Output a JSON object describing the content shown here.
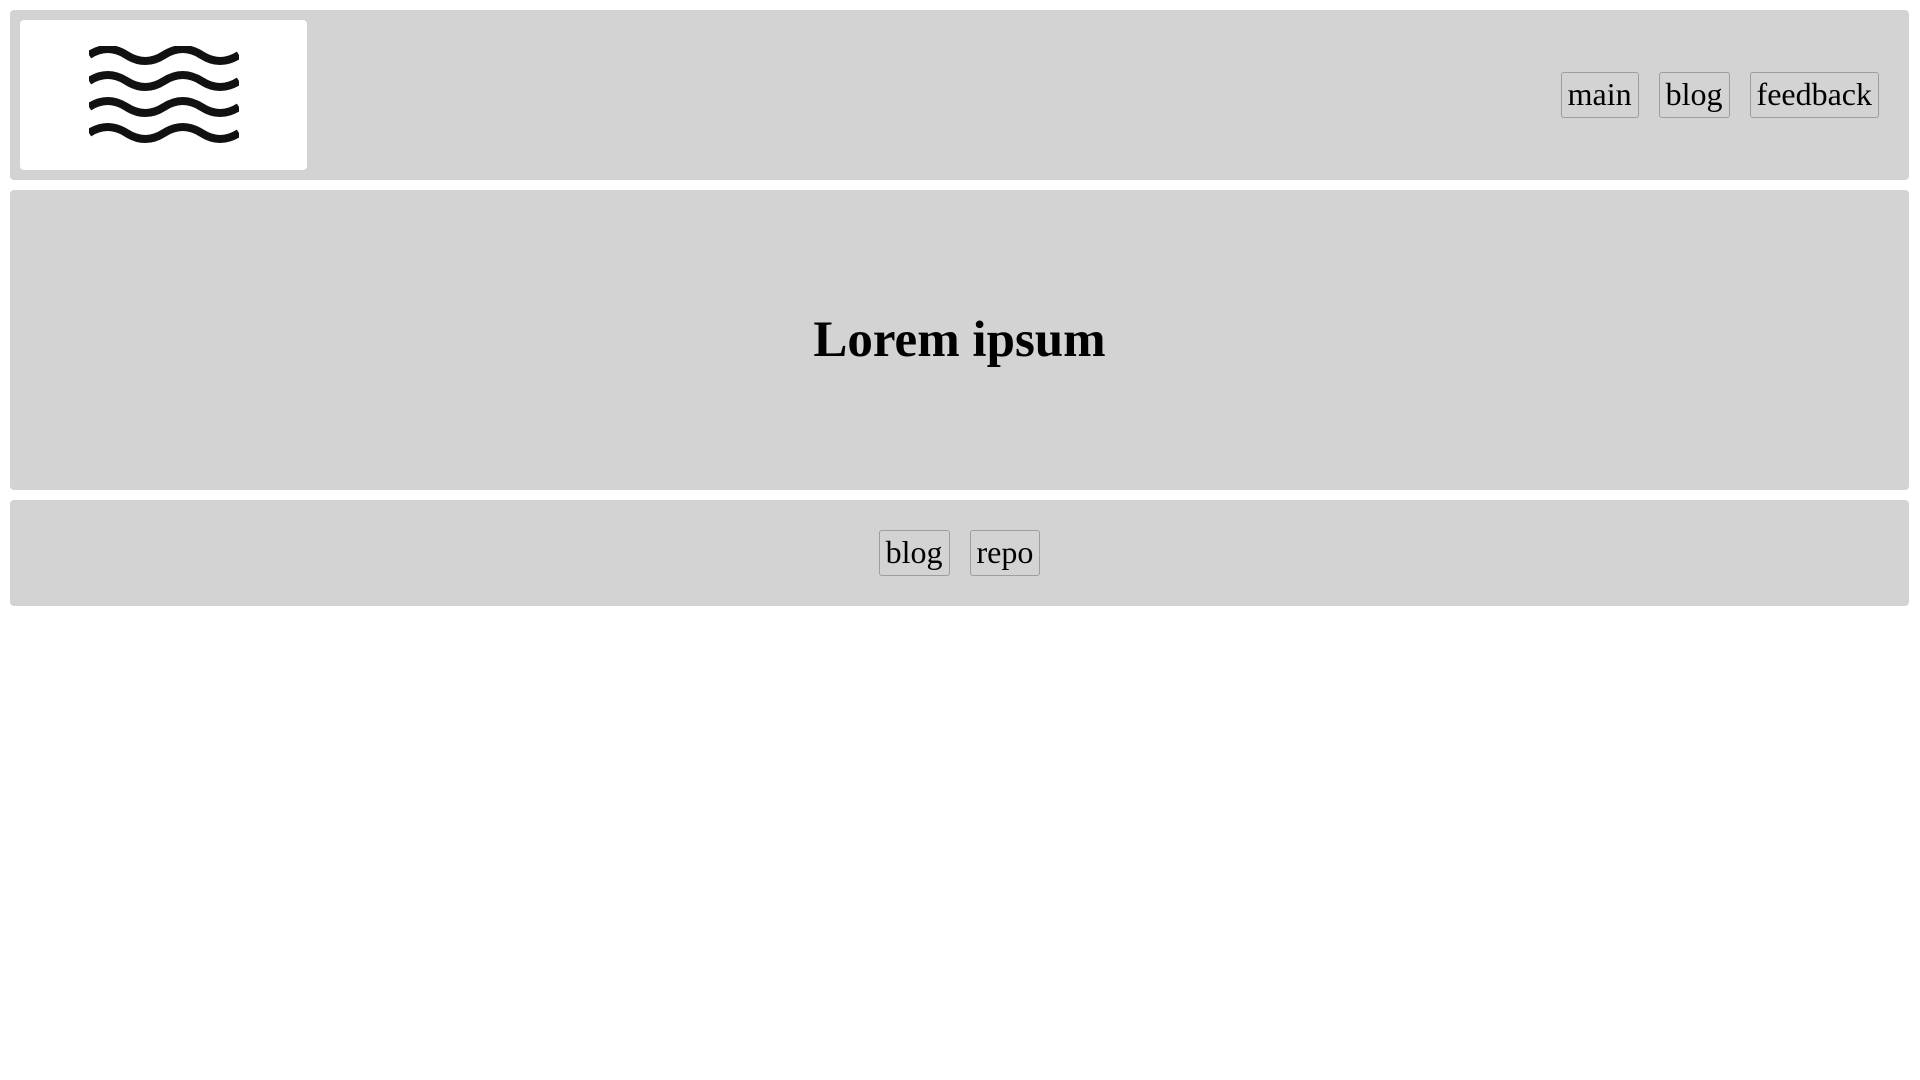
{
  "header": {
    "logo_icon": "waves-icon",
    "nav": [
      {
        "label": "main"
      },
      {
        "label": "blog"
      },
      {
        "label": "feedback"
      }
    ]
  },
  "hero": {
    "title": "Lorem ipsum"
  },
  "footer": {
    "links": [
      {
        "label": "blog"
      },
      {
        "label": "repo"
      }
    ]
  },
  "colors": {
    "panel_background": "#d3d3d3",
    "page_background": "#ffffff",
    "logo_background": "#ffffff",
    "text": "#000000"
  }
}
